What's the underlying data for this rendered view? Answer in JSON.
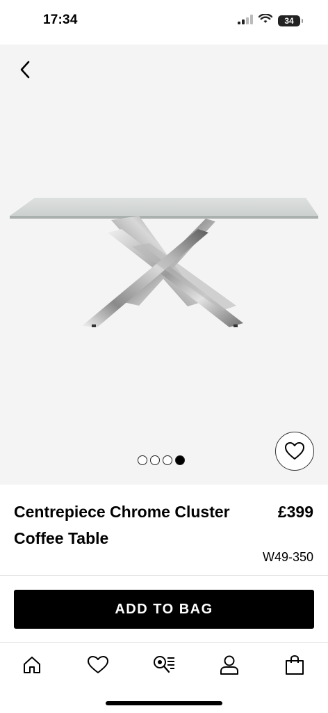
{
  "status": {
    "time": "17:34",
    "battery": "34",
    "icons": [
      "cellular-signal-icon",
      "wifi-icon",
      "battery-icon"
    ]
  },
  "gallery": {
    "back_icon": "chevron-left-icon",
    "image_count": 4,
    "active_index": 4,
    "wishlist_icon": "heart-icon"
  },
  "product": {
    "title": "Centrepiece Chrome Cluster Coffee Table",
    "price": "£399",
    "code": "W49-350"
  },
  "actions": {
    "add_to_bag_label": "ADD TO BAG"
  },
  "tabbar": {
    "items": [
      {
        "icon": "home-icon"
      },
      {
        "icon": "heart-icon"
      },
      {
        "icon": "search-list-icon"
      },
      {
        "icon": "account-icon"
      },
      {
        "icon": "shopping-bag-icon"
      }
    ]
  },
  "colors": {
    "accent": "#000000",
    "gallery_bg": "#f4f4f4"
  }
}
